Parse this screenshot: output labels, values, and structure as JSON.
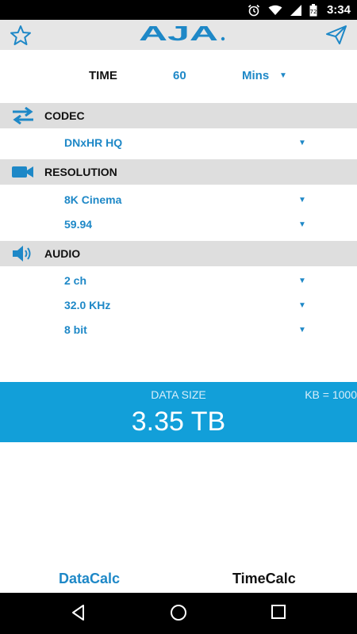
{
  "status_bar": {
    "time": "3:34"
  },
  "header": {
    "logo_text": "AJA"
  },
  "time_row": {
    "label": "TIME",
    "value": "60",
    "unit": "Mins"
  },
  "sections": {
    "codec": {
      "title": "CODEC",
      "options": [
        "DNxHR HQ"
      ]
    },
    "resolution": {
      "title": "RESOLUTION",
      "options": [
        "8K Cinema",
        "59.94"
      ]
    },
    "audio": {
      "title": "AUDIO",
      "options": [
        "2 ch",
        "32.0 KHz",
        "8 bit"
      ]
    }
  },
  "result": {
    "label": "DATA SIZE",
    "unit_note": "KB = 1000",
    "value": "3.35 TB"
  },
  "tabs": {
    "data_calc": "DataCalc",
    "time_calc": "TimeCalc"
  },
  "colors": {
    "accent": "#1e88c7",
    "band": "#129fd9",
    "header_gray": "#dedede"
  }
}
